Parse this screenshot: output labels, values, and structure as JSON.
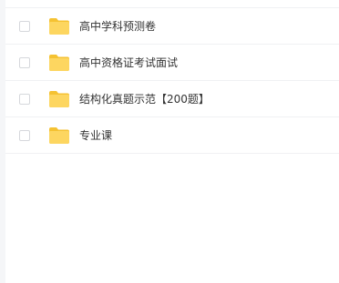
{
  "file_list": {
    "items": [
      {
        "name": "高中学科预测卷",
        "icon": "folder-icon"
      },
      {
        "name": "高中资格证考试面试",
        "icon": "folder-icon"
      },
      {
        "name": "结构化真题示范【200题】",
        "icon": "folder-icon"
      },
      {
        "name": "专业课",
        "icon": "folder-icon"
      }
    ]
  },
  "colors": {
    "folder_front": "#fdd660",
    "folder_back": "#f5c232",
    "text": "#333333",
    "divider": "#f0f1f3"
  }
}
